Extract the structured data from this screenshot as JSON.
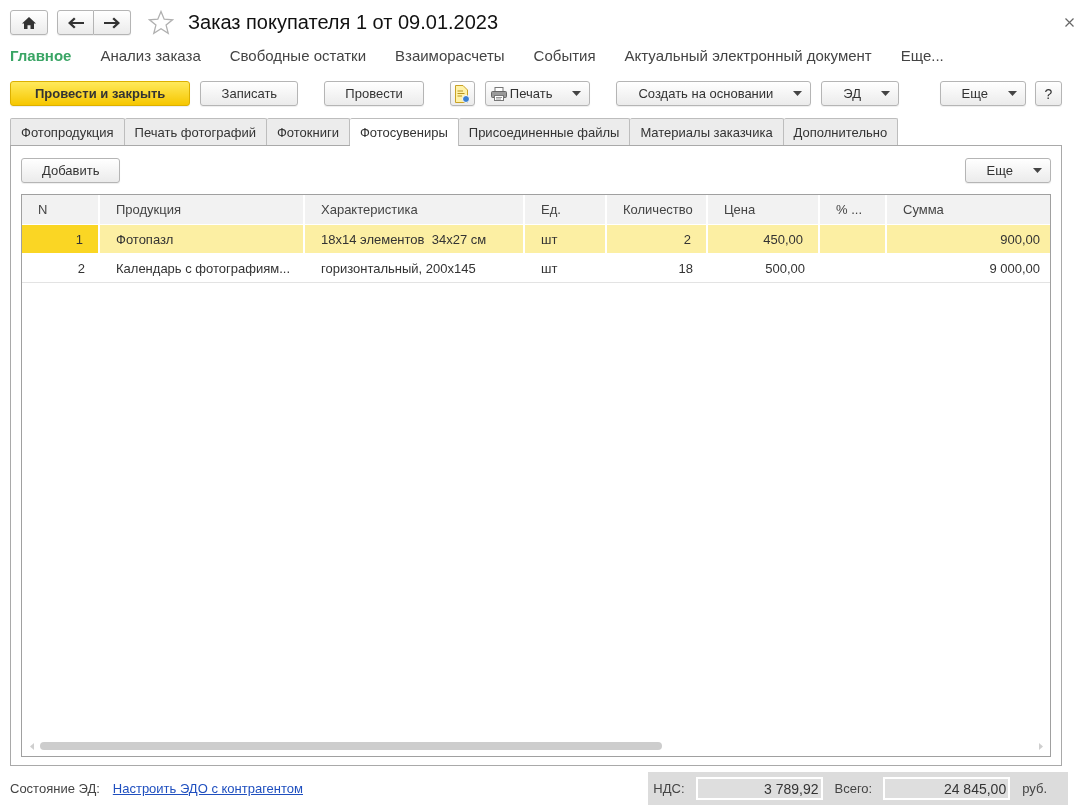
{
  "window": {
    "title": "Заказ покупателя 1 от 09.01.2023",
    "favorite": false
  },
  "nav": [
    {
      "label": "Главное",
      "selected": true
    },
    {
      "label": "Анализ заказа",
      "selected": false
    },
    {
      "label": "Свободные остатки",
      "selected": false
    },
    {
      "label": "Взаиморасчеты",
      "selected": false
    },
    {
      "label": "События",
      "selected": false
    },
    {
      "label": "Актуальный электронный документ",
      "selected": false
    },
    {
      "label": "Еще...",
      "selected": false
    }
  ],
  "toolbar": {
    "groups": [
      [
        {
          "kind": "primary",
          "label": "Провести и закрыть"
        },
        {
          "kind": "button",
          "label": "Записать"
        }
      ],
      [
        {
          "kind": "button",
          "label": "Провести"
        }
      ],
      [
        {
          "kind": "icon"
        },
        {
          "kind": "print",
          "label": "Печать"
        }
      ],
      [
        {
          "kind": "menu",
          "label": "Создать на основании"
        },
        {
          "kind": "menu",
          "label": "ЭД"
        }
      ]
    ],
    "right": [
      {
        "kind": "menu",
        "label": "Еще"
      },
      {
        "kind": "help",
        "label": "?"
      }
    ]
  },
  "tabs": [
    {
      "label": "Фотопродукция",
      "selected": false
    },
    {
      "label": "Печать фотографий",
      "selected": false
    },
    {
      "label": "Фотокниги",
      "selected": false
    },
    {
      "label": "Фотосувениры",
      "selected": true
    },
    {
      "label": "Присоединенные файлы",
      "selected": false
    },
    {
      "label": "Материалы заказчика",
      "selected": false
    },
    {
      "label": "Дополнительно",
      "selected": false
    }
  ],
  "panel": {
    "add_button": "Добавить",
    "more_menu": "Еще"
  },
  "table": {
    "columns": [
      "N",
      "Продукция",
      "Характеристика",
      "Ед.",
      "Количество",
      "Цена",
      "% ...",
      "Сумма"
    ],
    "rows": [
      {
        "selected": true,
        "n": "1",
        "product": "Фотопазл",
        "characteristic": "18x14 элементов  34x27 см",
        "unit": "шт",
        "quantity": "2",
        "price": "450,00",
        "sum": "900,00"
      },
      {
        "selected": false,
        "n": "2",
        "product": "Календарь с фотографиям...",
        "characteristic": "горизонтальный, 200x145",
        "unit": "шт",
        "quantity": "18",
        "price": "500,00",
        "sum": "9 000,00"
      }
    ]
  },
  "footer": {
    "status_label": "Состояние ЭД:",
    "link": "Настроить ЭДО с контрагентом",
    "totals": [
      {
        "label": "НДС:",
        "value": "3 789,92"
      },
      {
        "label": "Всего:",
        "value": "24 845,00"
      }
    ],
    "currency": "руб."
  }
}
